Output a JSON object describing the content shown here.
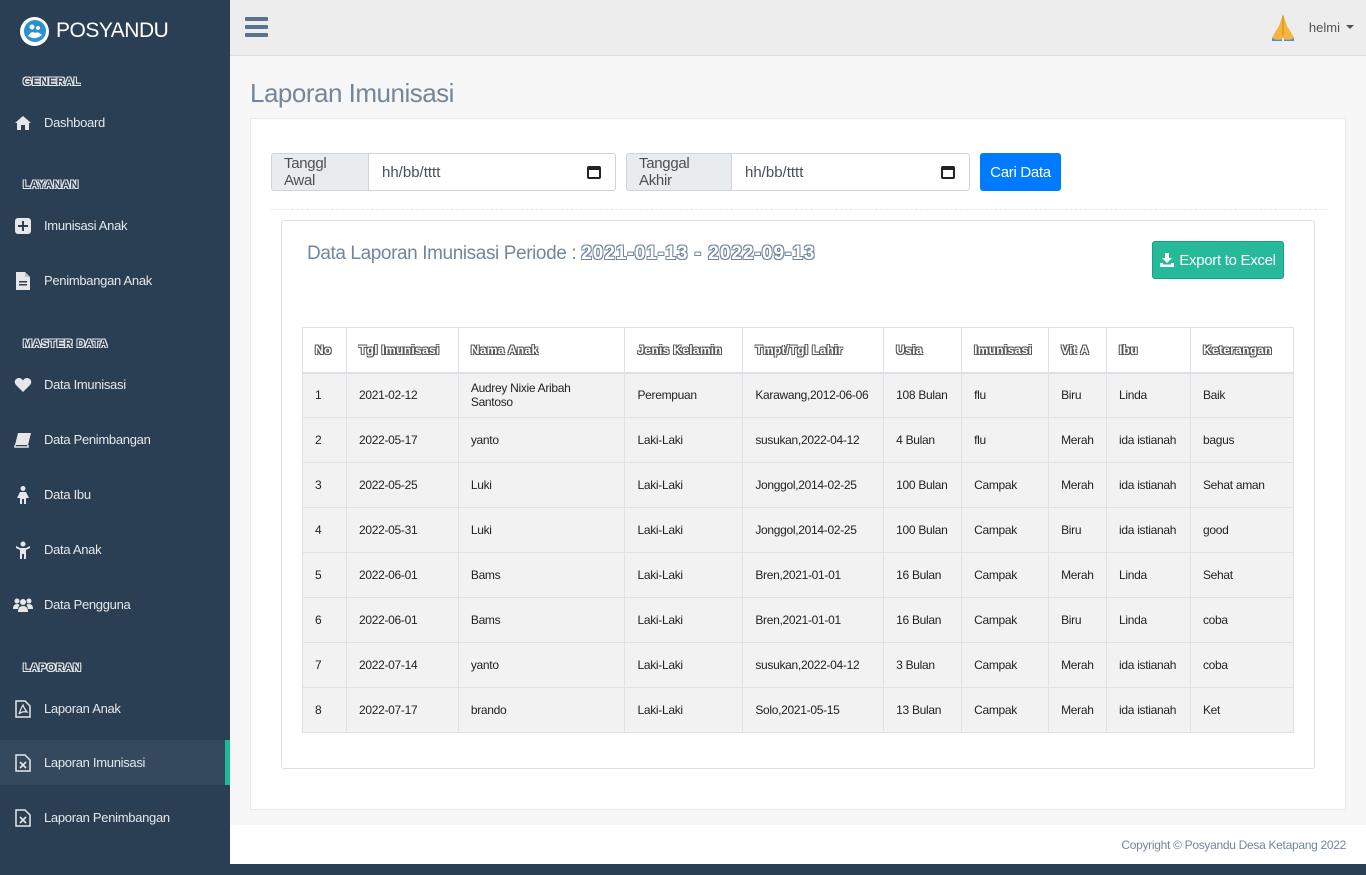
{
  "brand": {
    "name": "POSYANDU"
  },
  "sidebar": {
    "sections": [
      {
        "title": "GENERAL",
        "items": [
          {
            "label": "Dashboard",
            "icon": "home-icon"
          }
        ]
      },
      {
        "title": "LAYANAN",
        "items": [
          {
            "label": "Imunisasi Anak",
            "icon": "plus-square-icon"
          },
          {
            "label": "Penimbangan Anak",
            "icon": "file-text-icon"
          }
        ]
      },
      {
        "title": "MASTER DATA",
        "items": [
          {
            "label": "Data Imunisasi",
            "icon": "heart-icon"
          },
          {
            "label": "Data Penimbangan",
            "icon": "book-icon"
          },
          {
            "label": "Data Ibu",
            "icon": "female-icon"
          },
          {
            "label": "Data Anak",
            "icon": "child-icon"
          },
          {
            "label": "Data Pengguna",
            "icon": "users-icon"
          }
        ]
      },
      {
        "title": "LAPORAN",
        "items": [
          {
            "label": "Laporan Anak",
            "icon": "file-pdf-icon"
          },
          {
            "label": "Laporan Imunisasi",
            "icon": "file-excel-icon",
            "active": true
          },
          {
            "label": "Laporan Penimbangan",
            "icon": "file-excel-icon"
          }
        ]
      }
    ]
  },
  "topbar": {
    "username": "helmi"
  },
  "page": {
    "title": "Laporan Imunisasi",
    "filter": {
      "start_label": "Tanggl Awal",
      "start_value": "hh/bb/tttt",
      "end_label": "Tanggal Akhir",
      "end_value": "hh/bb/tttt",
      "search_label": "Cari Data"
    },
    "report": {
      "title": "Data Laporan Imunisasi Periode :",
      "period": "2021-01-13 - 2022-09-13",
      "export_label": "Export to Excel"
    },
    "table": {
      "headers": [
        "No",
        "Tgl Imunisasi",
        "Nama Anak",
        "Jenis Kelamin",
        "Tmpt/Tgl Lahir",
        "Usia",
        "Imunisasi",
        "Vit A",
        "Ibu",
        "Keterangan"
      ],
      "rows": [
        [
          "1",
          "2021-02-12",
          "Audrey Nixie Aribah Santoso",
          "Perempuan",
          "Karawang,2012-06-06",
          "108 Bulan",
          "flu",
          "Biru",
          "Linda",
          "Baik"
        ],
        [
          "2",
          "2022-05-17",
          "yanto",
          "Laki-Laki",
          "susukan,2022-04-12",
          "4 Bulan",
          "flu",
          "Merah",
          "ida istianah",
          "bagus"
        ],
        [
          "3",
          "2022-05-25",
          "Luki",
          "Laki-Laki",
          "Jonggol,2014-02-25",
          "100 Bulan",
          "Campak",
          "Merah",
          "ida istianah",
          "Sehat aman"
        ],
        [
          "4",
          "2022-05-31",
          "Luki",
          "Laki-Laki",
          "Jonggol,2014-02-25",
          "100 Bulan",
          "Campak",
          "Biru",
          "ida istianah",
          "good"
        ],
        [
          "5",
          "2022-06-01",
          "Bams",
          "Laki-Laki",
          "Bren,2021-01-01",
          "16 Bulan",
          "Campak",
          "Merah",
          "Linda",
          "Sehat"
        ],
        [
          "6",
          "2022-06-01",
          "Bams",
          "Laki-Laki",
          "Bren,2021-01-01",
          "16 Bulan",
          "Campak",
          "Biru",
          "Linda",
          "coba"
        ],
        [
          "7",
          "2022-07-14",
          "yanto",
          "Laki-Laki",
          "susukan,2022-04-12",
          "3 Bulan",
          "Campak",
          "Merah",
          "ida istianah",
          "coba"
        ],
        [
          "8",
          "2022-07-17",
          "brando",
          "Laki-Laki",
          "Solo,2021-05-15",
          "13 Bulan",
          "Campak",
          "Merah",
          "ida istianah",
          "Ket"
        ]
      ]
    }
  },
  "footer": {
    "copyright": "Copyright © Posyandu Desa Ketapang 2022"
  }
}
